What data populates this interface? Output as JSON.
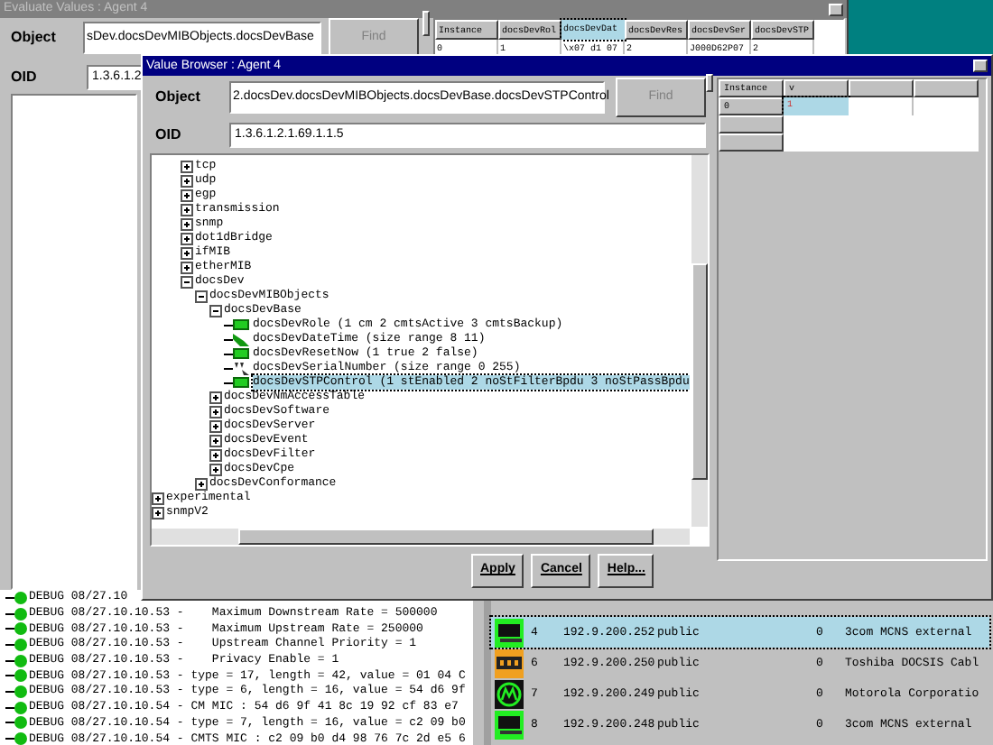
{
  "back_window": {
    "title": "Evaluate Values : Agent 4",
    "object_label": "Object",
    "object_value": "sDev.docsDevMIBObjects.docsDevBase",
    "find_button": "Find",
    "oid_label": "OID",
    "oid_value": "1.3.6.1.2",
    "table": {
      "columns": [
        {
          "label": "Instance",
          "selected": false
        },
        {
          "label": "docsDevRol",
          "selected": false
        },
        {
          "label": "docsDevDat",
          "selected": true
        },
        {
          "label": "docsDevRes",
          "selected": false
        },
        {
          "label": "docsDevSer",
          "selected": false
        },
        {
          "label": "docsDevSTP",
          "selected": false
        }
      ],
      "rows": [
        [
          "0",
          "1",
          "\\x07 d1 07",
          "2",
          "J000D62P07",
          "2"
        ]
      ]
    }
  },
  "value_browser": {
    "title": "Value Browser : Agent 4",
    "object_label": "Object",
    "object_value": "2.docsDev.docsDevMIBObjects.docsDevBase.docsDevSTPControl",
    "find_button": "Find",
    "oid_label": "OID",
    "oid_value": "1.3.6.1.2.1.69.1.1.5",
    "table": {
      "columns": [
        "Instance",
        "v"
      ],
      "rows": [
        {
          "instance": "0",
          "value": "1",
          "selected": true
        }
      ]
    },
    "tree": [
      {
        "children": [
          {
            "children": [
              {
                "label": "tcp",
                "expanded": false
              },
              {
                "label": "udp",
                "expanded": false
              },
              {
                "label": "egp",
                "expanded": false
              },
              {
                "label": "transmission",
                "expanded": false
              },
              {
                "label": "snmp",
                "expanded": false
              },
              {
                "label": "dot1dBridge",
                "expanded": false
              },
              {
                "label": "ifMIB",
                "expanded": false
              },
              {
                "label": "etherMIB",
                "expanded": false
              },
              {
                "label": "docsDev",
                "expanded": true,
                "children": [
                  {
                    "label": "docsDevMIBObjects",
                    "expanded": true,
                    "children": [
                      {
                        "label": "docsDevBase",
                        "expanded": true,
                        "children": [
                          {
                            "label": "docsDevRole (1 cm 2 cmtsActive 3 cmtsBackup)",
                            "kind": "number",
                            "selected": false
                          },
                          {
                            "label": "docsDevDateTime (size range 8 11)",
                            "kind": "string",
                            "selected": false
                          },
                          {
                            "label": "docsDevResetNow (1 true 2 false)",
                            "kind": "number",
                            "selected": false
                          },
                          {
                            "label": "docsDevSerialNumber (size range 0 255)",
                            "kind": "text",
                            "selected": false
                          },
                          {
                            "label": "docsDevSTPControl (1 stEnabled 2 noStFilterBpdu 3 noStPassBpdu",
                            "kind": "number",
                            "selected": true
                          }
                        ]
                      },
                      {
                        "label": "docsDevNmAccessTable",
                        "expanded": false
                      },
                      {
                        "label": "docsDevSoftware",
                        "expanded": false
                      },
                      {
                        "label": "docsDevServer",
                        "expanded": false
                      },
                      {
                        "label": "docsDevEvent",
                        "expanded": false
                      },
                      {
                        "label": "docsDevFilter",
                        "expanded": false
                      },
                      {
                        "label": "docsDevCpe",
                        "expanded": false
                      }
                    ]
                  },
                  {
                    "label": "docsDevConformance",
                    "expanded": false
                  }
                ]
              }
            ]
          }
        ]
      },
      {
        "label": "experimental",
        "expanded": false
      },
      {
        "label": "snmpV2",
        "expanded": false
      }
    ],
    "buttons": [
      "Apply",
      "Cancel",
      "Help..."
    ]
  },
  "log": [
    {
      "text": "DEBUG 08/27.10"
    },
    {
      "text": "DEBUG 08/27.10.10.53 -    Maximum Downstream Rate = 500000"
    },
    {
      "text": "DEBUG 08/27.10.10.53 -    Maximum Upstream Rate = 250000"
    },
    {
      "text": "DEBUG 08/27.10.10.53 -    Upstream Channel Priority = 1"
    },
    {
      "text": "DEBUG 08/27.10.10.53 -    Privacy Enable = 1"
    },
    {
      "text": "DEBUG 08/27.10.10.53 - type = 17, length = 42, value = 01 04 C"
    },
    {
      "text": "DEBUG 08/27.10.10.53 - type = 6, length = 16, value = 54 d6 9f"
    },
    {
      "text": "DEBUG 08/27.10.10.54 - CM MIC : 54 d6 9f 41 8c 19 92 cf 83 e7"
    },
    {
      "text": "DEBUG 08/27.10.10.54 - type = 7, length = 16, value = c2 09 b0"
    },
    {
      "text": "DEBUG 08/27.10.10.54 - CMTS MIC : c2 09 b0 d4 98 76 7c 2d e5 6"
    }
  ],
  "devices": [
    {
      "kind": "modem",
      "number": "4",
      "address": "192.9.200.252",
      "community": "public",
      "count": "0",
      "vendor": "3com MCNS external",
      "selected": true
    },
    {
      "kind": "adapter",
      "number": "6",
      "address": "192.9.200.250",
      "community": "public",
      "count": "0",
      "vendor": "Toshiba DOCSIS Cabl",
      "selected": false
    },
    {
      "kind": "logo",
      "number": "7",
      "address": "192.9.200.249",
      "community": "public",
      "count": "0",
      "vendor": "Motorola Corporatio",
      "selected": false
    },
    {
      "kind": "modem",
      "number": "8",
      "address": "192.9.200.248",
      "community": "public",
      "count": "0",
      "vendor": "3com MCNS external",
      "selected": false
    }
  ]
}
